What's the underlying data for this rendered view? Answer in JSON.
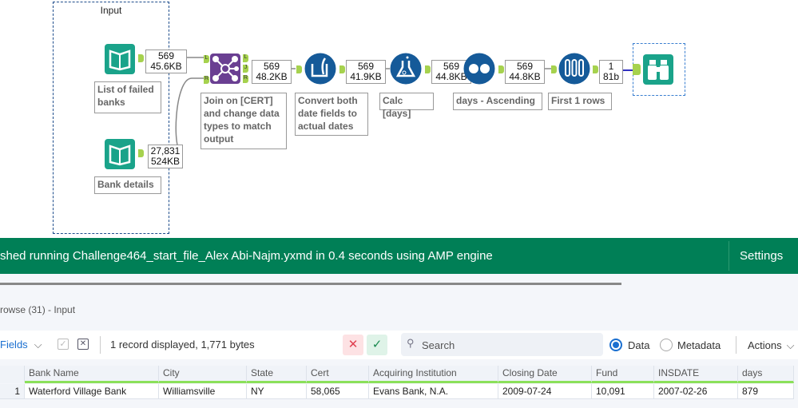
{
  "canvas": {
    "container_title": "Input",
    "nodes": [
      {
        "name": "input-failed-banks",
        "annotation": "List of failed banks",
        "count": "569",
        "size": "45.6KB"
      },
      {
        "name": "input-bank-details",
        "annotation": "Bank details",
        "count": "27,831",
        "size": "524KB"
      },
      {
        "name": "join",
        "annotation": "Join on [CERT] and change data types to match output",
        "count": "569",
        "size": "48.2KB",
        "anchors": [
          "L",
          "R",
          "L",
          "J",
          "R"
        ]
      },
      {
        "name": "formula",
        "annotation": "Convert both date fields to actual dates",
        "count": "569",
        "size": "41.9KB"
      },
      {
        "name": "calc",
        "annotation": "Calc [days]",
        "count": "569",
        "size": "44.8KB"
      },
      {
        "name": "sort",
        "annotation": "days - Ascending",
        "count": "569",
        "size": "44.8KB"
      },
      {
        "name": "sample",
        "annotation": "First 1 rows",
        "count": "1",
        "size": "81b"
      },
      {
        "name": "browse"
      }
    ]
  },
  "status": {
    "message": "shed running Challenge464_start_file_Alex Abi-Najm.yxmd in 0.4 seconds using AMP engine",
    "settings": "Settings",
    "color": "#007f56"
  },
  "results": {
    "title": "rowse (31) - Input",
    "fields_label": "Fields",
    "record_info": "1 record displayed, 1,771 bytes",
    "search_placeholder": "Search",
    "radio_data": "Data",
    "radio_metadata": "Metadata",
    "actions": "Actions",
    "columns": [
      "Bank Name",
      "City",
      "State",
      "Cert",
      "Acquiring Institution",
      "Closing Date",
      "Fund",
      "INSDATE",
      "days"
    ],
    "rows": [
      {
        "num": "1",
        "cells": [
          "Waterford Village Bank",
          "Williamsville",
          "NY",
          "58,065",
          "Evans Bank, N.A.",
          "2009-07-24",
          "10,091",
          "2007-02-26",
          "879"
        ]
      }
    ]
  }
}
